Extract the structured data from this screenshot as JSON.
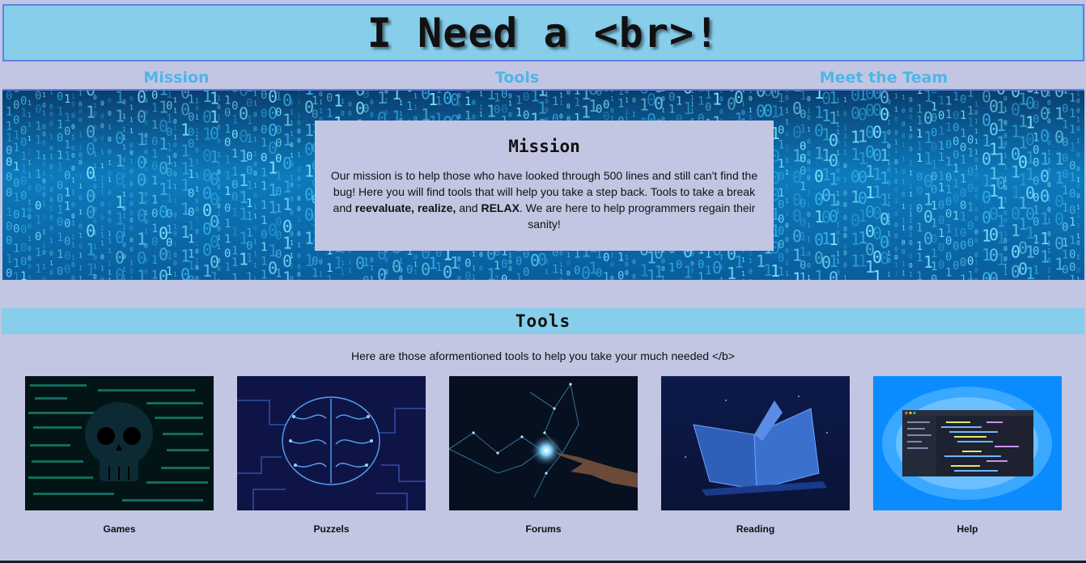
{
  "header": {
    "title": "I Need a <br>!"
  },
  "nav": {
    "items": [
      "Mission",
      "Tools",
      "Meet the Team"
    ]
  },
  "mission": {
    "heading": "Mission",
    "text_1": "Our mission is to help those who have looked through 500 lines and still can't find the bug! Here you will find tools that will help you take a step back. Tools to take a break and ",
    "bold_1": "reevaluate, realize,",
    "text_2": " and ",
    "bold_2": "RELAX",
    "text_3": ". We are here to help programmers regain their sanity!"
  },
  "tools": {
    "heading": "Tools",
    "intro": "Here are those aformentioned tools to help you take your much needed </b>",
    "cards": [
      {
        "label": "Games",
        "image": "skull-code-image"
      },
      {
        "label": "Puzzels",
        "image": "circuit-brain-image"
      },
      {
        "label": "Forums",
        "image": "digital-hand-image"
      },
      {
        "label": "Reading",
        "image": "digital-book-image"
      },
      {
        "label": "Help",
        "image": "code-editor-image"
      }
    ]
  },
  "colors": {
    "background": "#c2c6e3",
    "header_bg": "#87ceeb",
    "header_border": "#5e7fe6",
    "nav_link": "#4fb6e6"
  }
}
